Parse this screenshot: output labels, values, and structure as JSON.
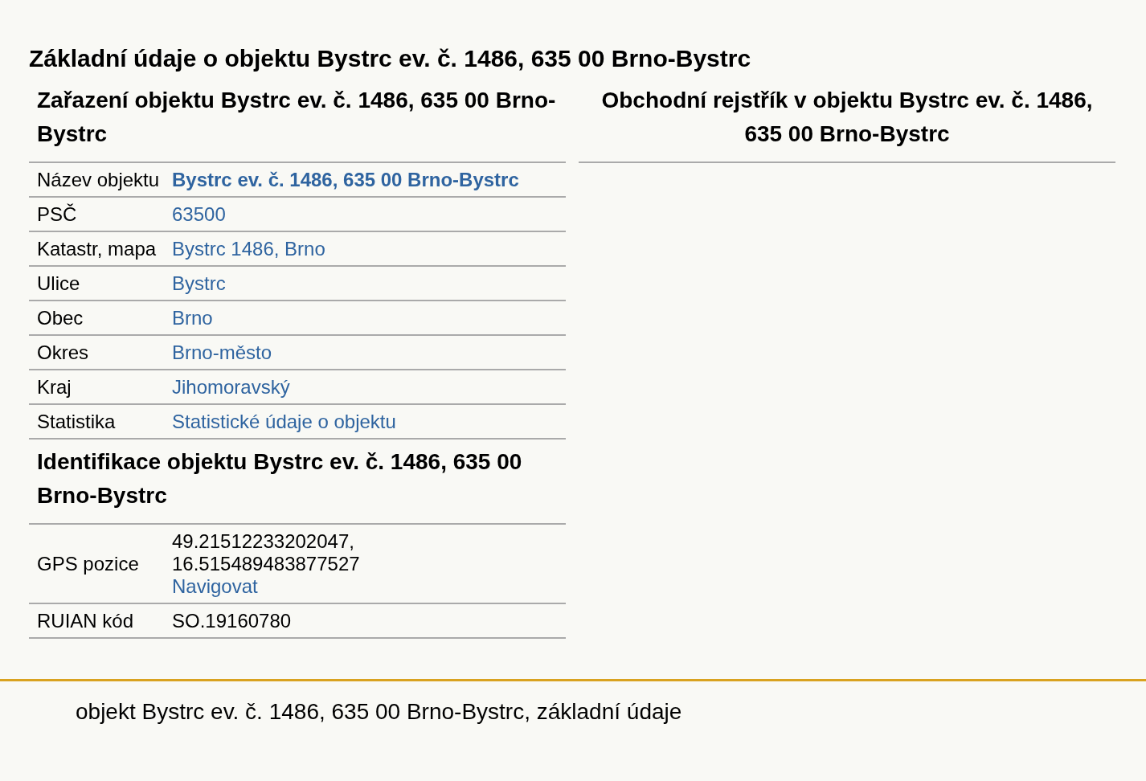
{
  "page_title": "Základní údaje o objektu Bystrc ev. č. 1486, 635 00 Brno-Bystrc",
  "left_sections": [
    {
      "heading": "Zařazení objektu Bystrc ev. č. 1486, 635 00 Brno-Bystrc",
      "rows": [
        {
          "label": "Název objektu",
          "parts": [
            {
              "kind": "strong-link",
              "text": "Bystrc ev. č. 1486, 635 00 Brno-Bystrc"
            }
          ]
        },
        {
          "label": "PSČ",
          "parts": [
            {
              "kind": "link",
              "text": "63500"
            }
          ]
        },
        {
          "label": "Katastr, mapa",
          "parts": [
            {
              "kind": "link",
              "text": "Bystrc 1486, Brno"
            }
          ]
        },
        {
          "label": "Ulice",
          "parts": [
            {
              "kind": "link",
              "text": "Bystrc"
            }
          ]
        },
        {
          "label": "Obec",
          "parts": [
            {
              "kind": "link",
              "text": "Brno"
            }
          ]
        },
        {
          "label": "Okres",
          "parts": [
            {
              "kind": "link",
              "text": "Brno-město"
            }
          ]
        },
        {
          "label": "Kraj",
          "parts": [
            {
              "kind": "link",
              "text": "Jihomoravský"
            }
          ]
        },
        {
          "label": "Statistika",
          "parts": [
            {
              "kind": "link",
              "text": "Statistické údaje o objektu"
            }
          ]
        }
      ]
    },
    {
      "heading": "Identifikace objektu Bystrc ev. č. 1486, 635 00 Brno-Bystrc",
      "rows": [
        {
          "label": "GPS pozice",
          "parts": [
            {
              "kind": "text",
              "text": "49.21512233202047,"
            },
            {
              "kind": "text",
              "text": "16.515489483877527"
            },
            {
              "kind": "link",
              "text": "Navigovat"
            }
          ]
        },
        {
          "label": "RUIAN kód",
          "parts": [
            {
              "kind": "text",
              "text": "SO.19160780"
            }
          ]
        }
      ]
    }
  ],
  "right_section": {
    "heading": "Obchodní rejstřík v objektu Bystrc ev. č. 1486, 635 00 Brno-Bystrc"
  },
  "footer": {
    "text": "objekt Bystrc ev. č. 1486, 635 00 Brno-Bystrc, základní údaje"
  }
}
